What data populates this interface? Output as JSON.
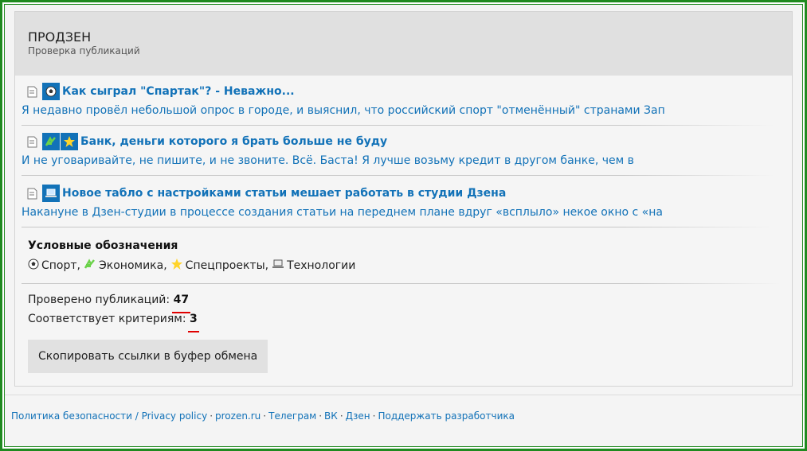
{
  "header": {
    "title": "ПРОДЗЕН",
    "subtitle": "Проверка публикаций"
  },
  "articles": [
    {
      "title": "Как сыграл \"Спартак\"? - Неважно...",
      "excerpt": "Я недавно провёл небольшой опрос в городе, и выяснил, что российский спорт \"отменённый\" странами Зап",
      "categories": [
        "sport-icon"
      ]
    },
    {
      "title": "Банк, деньги которого я брать больше не буду",
      "excerpt": "И не уговаривайте, не пишите, и не звоните. Всё. Баста! Я лучше возьму кредит в другом банке, чем в",
      "categories": [
        "economy-icon",
        "special-projects-icon"
      ]
    },
    {
      "title": "Новое табло с настройками статьи мешает работать в студии Дзена",
      "excerpt": "Накануне в Дзен-студии в процессе создания статьи на переднем плане вдруг «всплыло» некое окно с «на",
      "categories": [
        "technology-icon"
      ]
    }
  ],
  "legend": {
    "title": "Условные обозначения",
    "items": [
      {
        "icon": "sport-icon",
        "label": "Спорт,"
      },
      {
        "icon": "economy-icon",
        "label": "Экономика,"
      },
      {
        "icon": "special-projects-icon",
        "label": "Спецпроекты,"
      },
      {
        "icon": "technology-icon",
        "label": "Технологии"
      }
    ]
  },
  "stats": {
    "checked_label": "Проверено публикаций:",
    "checked_value": "47",
    "matching_label": "Соответствует критериям:",
    "matching_value": "3"
  },
  "copy_button_label": "Скопировать ссылки в буфер обмена",
  "footer": {
    "links": [
      "Политика безопасности / Privacy policy",
      "prozen.ru",
      "Телеграм",
      "ВК",
      "Дзен",
      "Поддержать разработчика"
    ],
    "separator": "·"
  },
  "colors": {
    "border_green": "#1f8a1f",
    "link_blue": "#1272b8",
    "badge_blue": "#1272b8",
    "underline_red": "#e00000",
    "header_bg": "#e0e0e0"
  }
}
